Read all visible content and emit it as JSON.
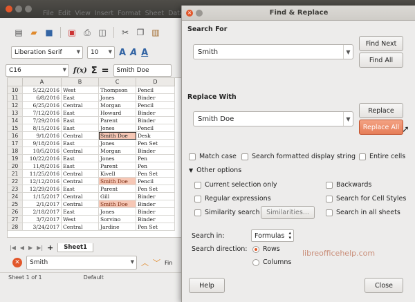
{
  "calc": {
    "menu": [
      "File",
      "Edit",
      "View",
      "Insert",
      "Format",
      "Sheet",
      "Data"
    ],
    "font_name": "Liberation Serif",
    "font_size": "10",
    "cell_ref": "C16",
    "formula_value": "Smith Doe",
    "columns": [
      "",
      "A",
      "B",
      "C",
      "D"
    ],
    "rows": [
      {
        "n": "10",
        "a": "5/22/2016",
        "b": "West",
        "c": "Thompson",
        "d": "Pencil",
        "hl": false
      },
      {
        "n": "11",
        "a": "6/8/2016",
        "b": "East",
        "c": "Jones",
        "d": "Binder",
        "hl": false
      },
      {
        "n": "12",
        "a": "6/25/2016",
        "b": "Central",
        "c": "Morgan",
        "d": "Pencil",
        "hl": false
      },
      {
        "n": "13",
        "a": "7/12/2016",
        "b": "East",
        "c": "Howard",
        "d": "Binder",
        "hl": false
      },
      {
        "n": "14",
        "a": "7/29/2016",
        "b": "East",
        "c": "Parent",
        "d": "Binder",
        "hl": false
      },
      {
        "n": "15",
        "a": "8/15/2016",
        "b": "East",
        "c": "Jones",
        "d": "Pencil",
        "hl": false
      },
      {
        "n": "16",
        "a": "9/1/2016",
        "b": "Central",
        "c": "Smith Doe",
        "d": "Desk",
        "hl": "cur"
      },
      {
        "n": "17",
        "a": "9/18/2016",
        "b": "East",
        "c": "Jones",
        "d": "Pen Set",
        "hl": false
      },
      {
        "n": "18",
        "a": "10/5/2016",
        "b": "Central",
        "c": "Morgan",
        "d": "Binder",
        "hl": false
      },
      {
        "n": "19",
        "a": "10/22/2016",
        "b": "East",
        "c": "Jones",
        "d": "Pen",
        "hl": false
      },
      {
        "n": "20",
        "a": "11/8/2016",
        "b": "East",
        "c": "Parent",
        "d": "Pen",
        "hl": false
      },
      {
        "n": "21",
        "a": "11/25/2016",
        "b": "Central",
        "c": "Kivell",
        "d": "Pen Set",
        "hl": false
      },
      {
        "n": "22",
        "a": "12/12/2016",
        "b": "Central",
        "c": "Smith Doe",
        "d": "Pencil",
        "hl": "hl"
      },
      {
        "n": "23",
        "a": "12/29/2016",
        "b": "East",
        "c": "Parent",
        "d": "Pen Set",
        "hl": false
      },
      {
        "n": "24",
        "a": "1/15/2017",
        "b": "Central",
        "c": "Gill",
        "d": "Binder",
        "hl": false
      },
      {
        "n": "25",
        "a": "2/1/2017",
        "b": "Central",
        "c": "Smith Doe",
        "d": "Binder",
        "hl": "hl"
      },
      {
        "n": "26",
        "a": "2/18/2017",
        "b": "East",
        "c": "Jones",
        "d": "Binder",
        "hl": false
      },
      {
        "n": "27",
        "a": "3/7/2017",
        "b": "West",
        "c": "Sorvino",
        "d": "Binder",
        "hl": false
      },
      {
        "n": "28",
        "a": "3/24/2017",
        "b": "Central",
        "c": "Jardine",
        "d": "Pen Set",
        "hl": false
      }
    ],
    "sheet_tab": "Sheet1",
    "find_text": "Smith",
    "find_label": "Fin",
    "status_sheet": "Sheet 1 of 1",
    "status_style": "Default"
  },
  "dialog": {
    "title": "Find & Replace",
    "search_for_label": "Search For",
    "search_value": "Smith",
    "find_next": "Find Next",
    "find_all": "Find All",
    "replace_with_label": "Replace With",
    "replace_value": "Smith Doe",
    "replace": "Replace",
    "replace_all": "Replace All",
    "match_case": "Match case",
    "search_formatted": "Search formatted display string",
    "entire_cells": "Entire cells",
    "other_options": "Other options",
    "current_selection": "Current selection only",
    "backwards": "Backwards",
    "regex": "Regular expressions",
    "cell_styles": "Search for Cell Styles",
    "similarity": "Similarity search",
    "similarities": "Similarities...",
    "all_sheets": "Search in all sheets",
    "search_in_label": "Search in:",
    "search_in_value": "Formulas",
    "direction_label": "Search direction:",
    "rows": "Rows",
    "columns": "Columns",
    "watermark": "libreofficehelp.com",
    "help": "Help",
    "close": "Close"
  },
  "colors": {
    "accent": "#e67d58",
    "highlight": "#f6c7b5"
  }
}
